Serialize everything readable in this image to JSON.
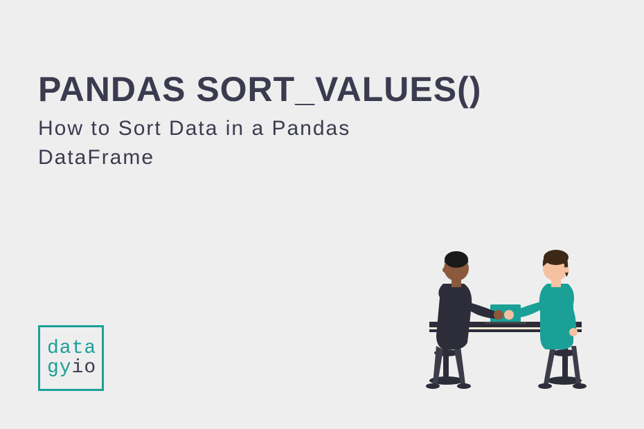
{
  "title": "PANDAS SORT_VALUES()",
  "subtitle": "How to Sort Data in a Pandas DataFrame",
  "logo": {
    "line1": "data",
    "line2_gy": "gy",
    "line2_io": "io"
  },
  "colors": {
    "background": "#eeeeee",
    "text": "#3a3b4f",
    "accent": "#1ba098"
  }
}
